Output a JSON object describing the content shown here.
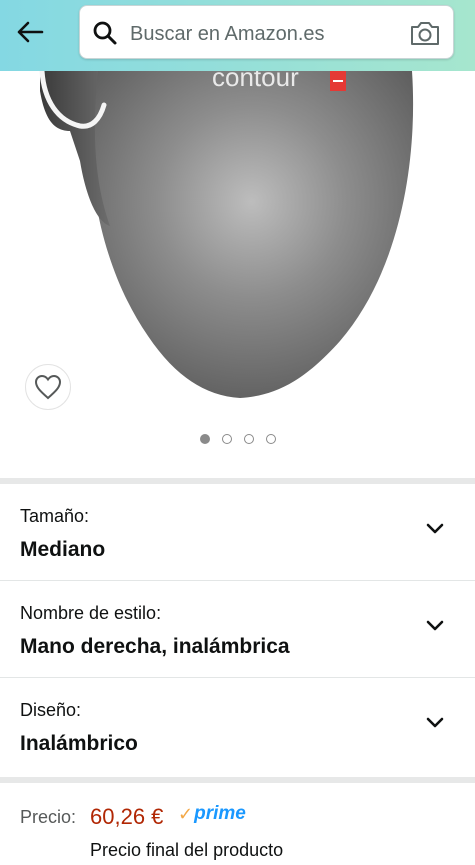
{
  "header": {
    "back_icon": "arrow-left-icon",
    "search": {
      "placeholder": "Buscar en Amazon.es",
      "value": ""
    },
    "camera_icon": "camera-icon",
    "search_icon": "search-icon"
  },
  "product": {
    "image_brand_text": "contour",
    "favorite_icon": "heart-icon",
    "carousel": {
      "total": 4,
      "active_index": 0
    }
  },
  "variants": [
    {
      "label": "Tamaño:",
      "value": "Mediano"
    },
    {
      "label": "Nombre de estilo:",
      "value": "Mano derecha, inalámbrica"
    },
    {
      "label": "Diseño:",
      "value": "Inalámbrico"
    }
  ],
  "price": {
    "label": "Precio:",
    "value": "60,26 €",
    "prime_check": "✓",
    "prime_label": "prime",
    "note": "Precio final del producto"
  },
  "colors": {
    "price": "#b12704",
    "prime": "#1a98ff",
    "prime_check": "#f3a847",
    "header_start": "#84d8e3",
    "header_end": "#a6e6ce"
  }
}
